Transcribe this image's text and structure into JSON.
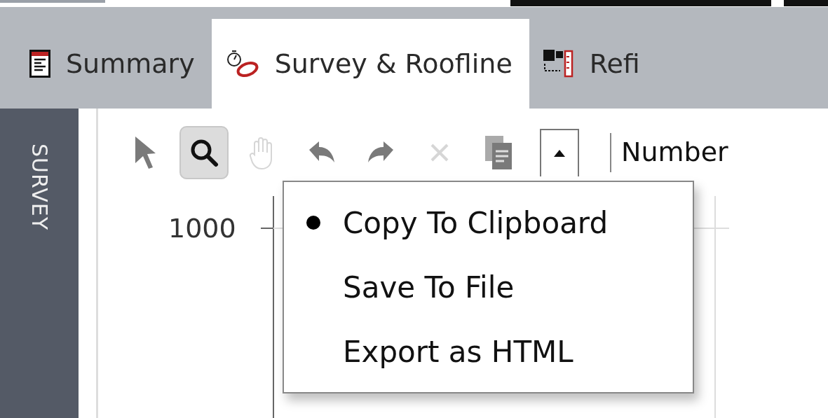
{
  "tabs": [
    {
      "label": "Summary",
      "kind": "report",
      "selected": false
    },
    {
      "label": "Survey & Roofline",
      "kind": "stopwatch",
      "selected": true
    },
    {
      "label": "Refi",
      "kind": "matrix",
      "selected": false
    }
  ],
  "sidebar": {
    "label": "SURVEY"
  },
  "toolbar": {
    "tools": [
      {
        "kind": "pointer",
        "selected": false,
        "disabled": false
      },
      {
        "kind": "zoom",
        "selected": true,
        "disabled": false
      },
      {
        "kind": "pan",
        "selected": false,
        "disabled": true
      },
      {
        "kind": "undo",
        "selected": false,
        "disabled": false
      },
      {
        "kind": "redo",
        "selected": false,
        "disabled": false
      },
      {
        "kind": "clear",
        "selected": false,
        "disabled": true
      },
      {
        "kind": "copy",
        "selected": false,
        "disabled": false
      },
      {
        "kind": "toggle",
        "expanded": true
      }
    ],
    "label": "Number"
  },
  "chart": {
    "y_tick_label": "1000"
  },
  "menu": {
    "items": [
      {
        "label": "Copy To Clipboard",
        "selected": true
      },
      {
        "label": "Save To File",
        "selected": false
      },
      {
        "label": "Export as HTML",
        "selected": false
      }
    ]
  }
}
